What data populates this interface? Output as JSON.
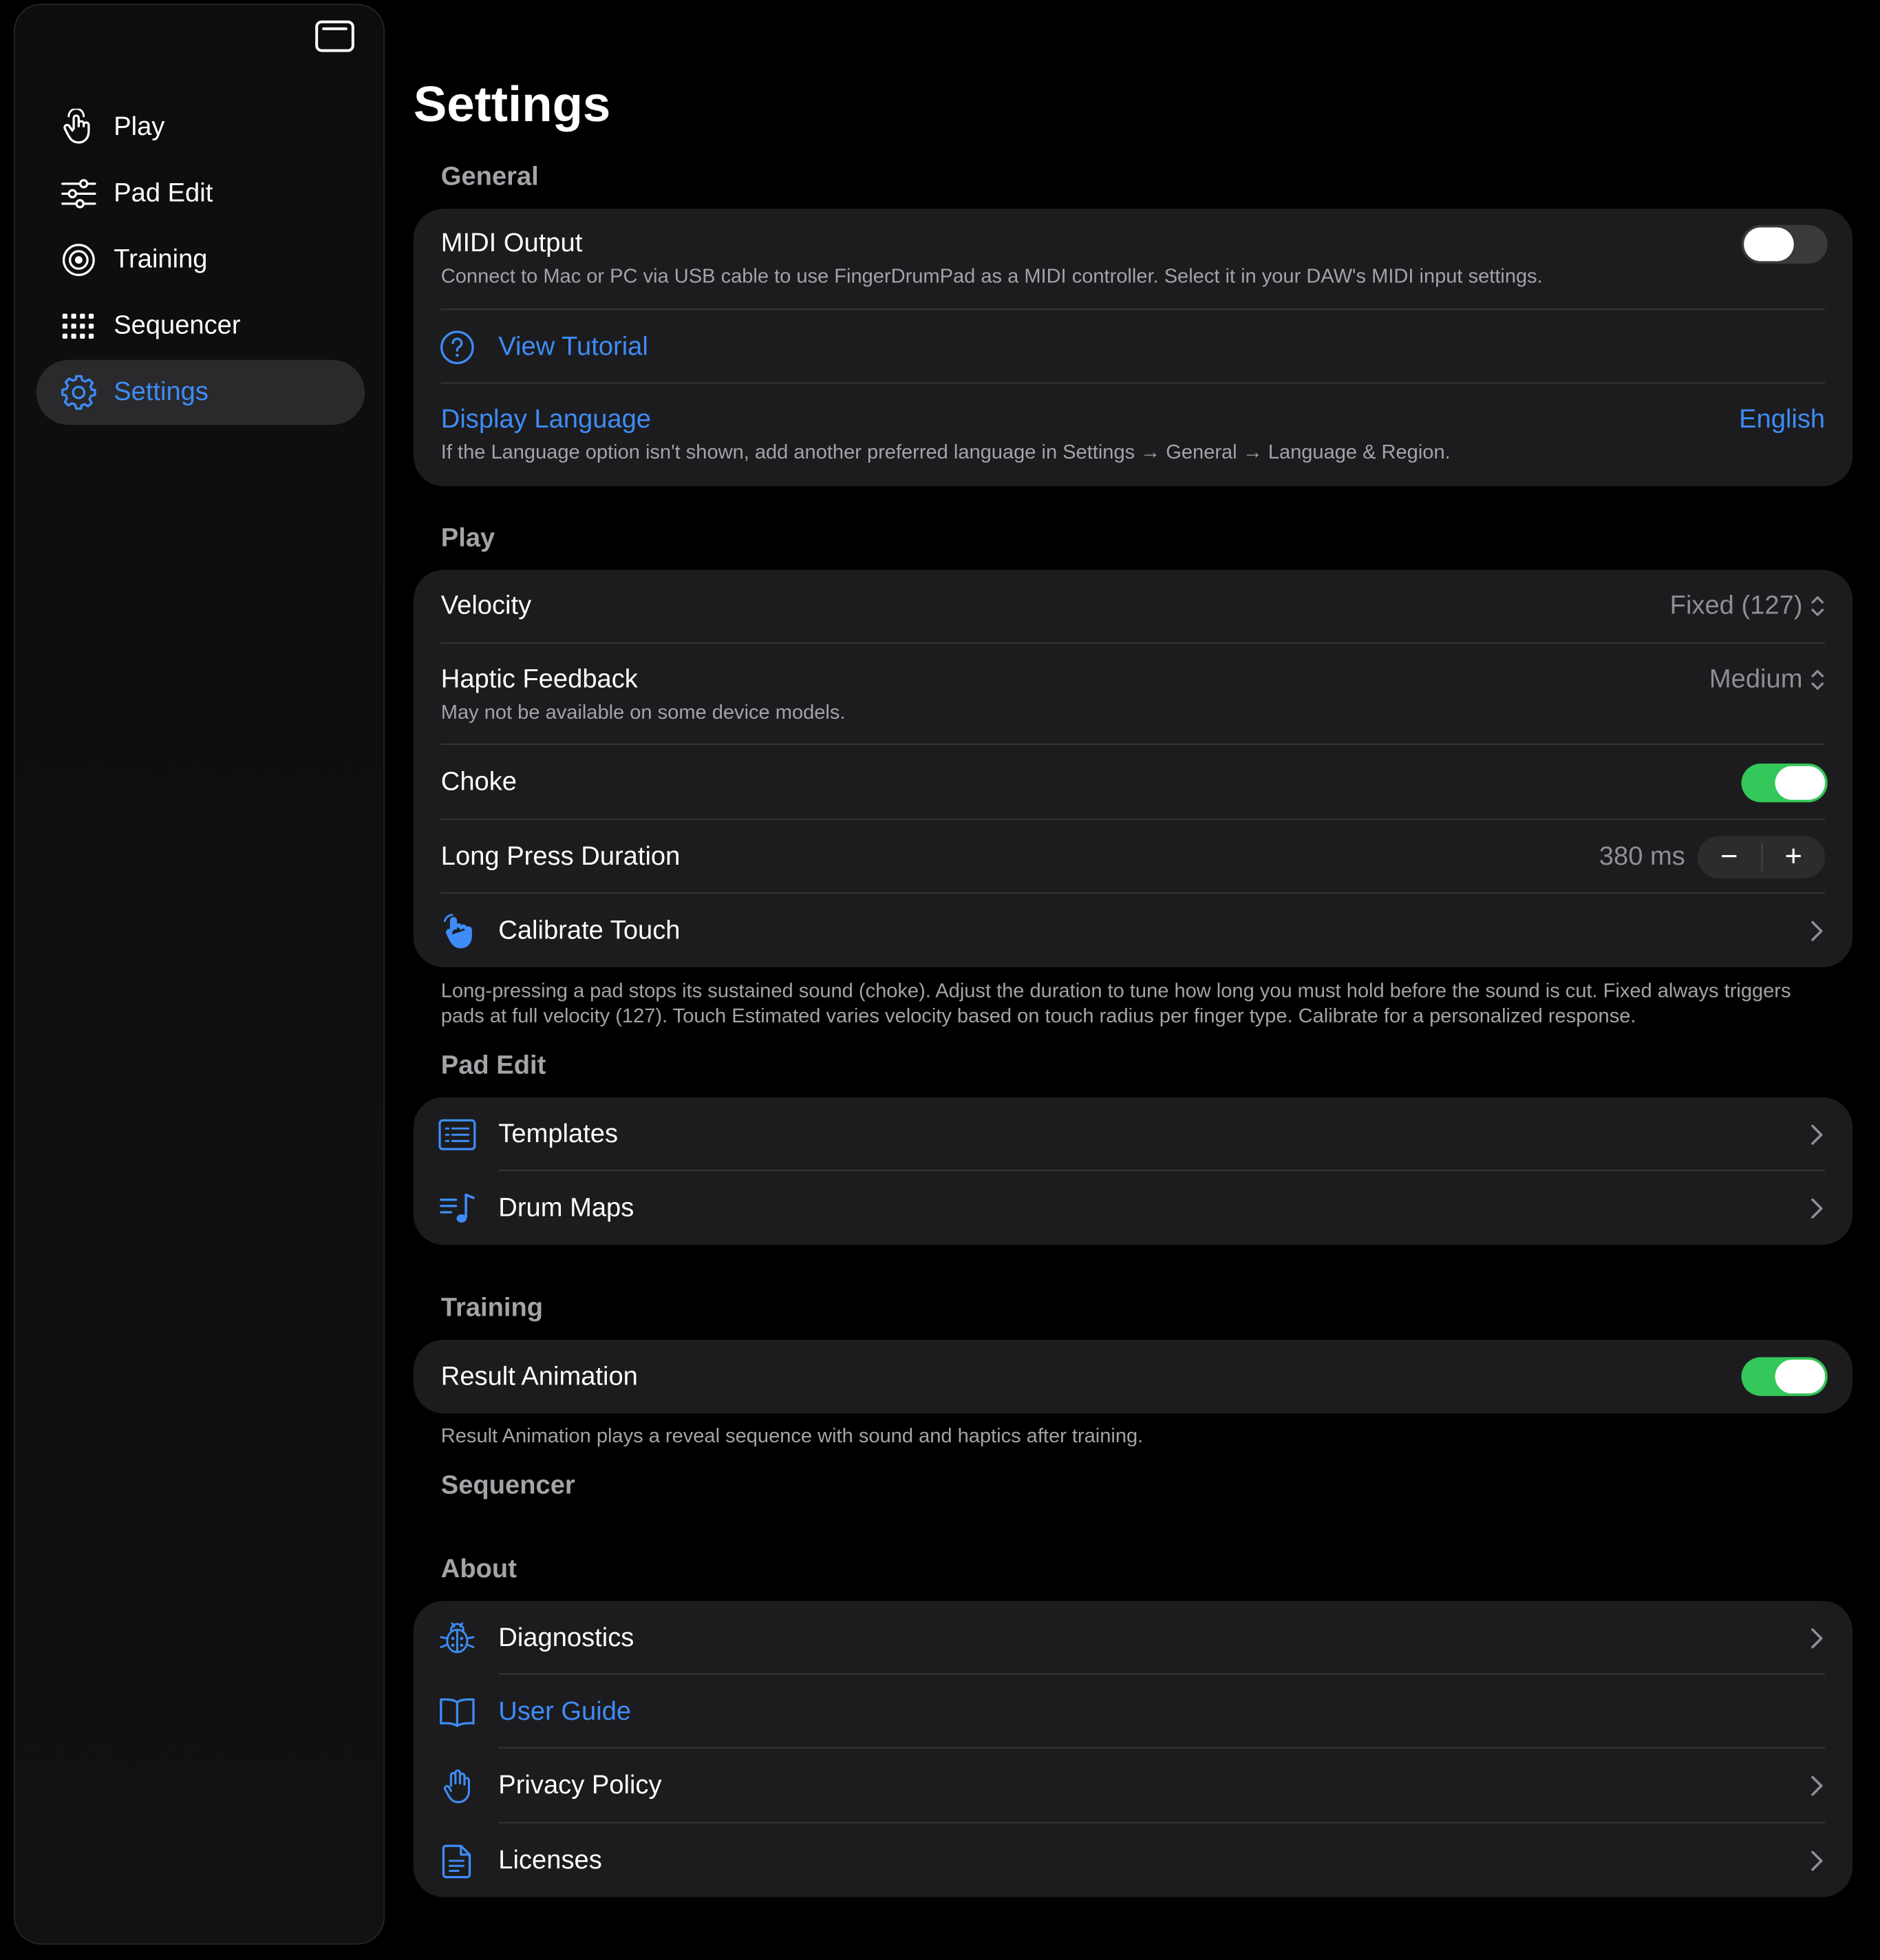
{
  "sidebar": {
    "items": [
      {
        "label": "Play",
        "icon": "hand-tap-icon",
        "active": false
      },
      {
        "label": "Pad Edit",
        "icon": "sliders-icon",
        "active": false
      },
      {
        "label": "Training",
        "icon": "target-icon",
        "active": false
      },
      {
        "label": "Sequencer",
        "icon": "grid-dots-icon",
        "active": false
      },
      {
        "label": "Settings",
        "icon": "gear-icon",
        "active": true
      }
    ]
  },
  "page": {
    "title": "Settings"
  },
  "general": {
    "header": "General",
    "midi_output": {
      "title": "MIDI Output",
      "subtitle": "Connect to Mac or PC via USB cable to use FingerDrumPad as a MIDI controller. Select it in your DAW's MIDI input settings.",
      "enabled": false
    },
    "view_tutorial": {
      "title": "View Tutorial"
    },
    "display_language": {
      "title": "Display Language",
      "value": "English",
      "subtitle": "If the Language option isn't shown, add another preferred language in Settings → General → Language & Region."
    }
  },
  "play": {
    "header": "Play",
    "velocity": {
      "title": "Velocity",
      "value": "Fixed (127)"
    },
    "haptic": {
      "title": "Haptic Feedback",
      "value": "Medium",
      "subtitle": "May not be available on some device models."
    },
    "choke": {
      "title": "Choke",
      "enabled": true
    },
    "long_press": {
      "title": "Long Press Duration",
      "value": "380 ms",
      "minus": "−",
      "plus": "+"
    },
    "calibrate": {
      "title": "Calibrate Touch"
    },
    "footnote": "Long-pressing a pad stops its sustained sound (choke). Adjust the duration to tune how long you must hold before the sound is cut. Fixed always triggers pads at full velocity (127). Touch Estimated varies velocity based on touch radius per finger type. Calibrate for a personalized response."
  },
  "pad_edit": {
    "header": "Pad Edit",
    "templates": {
      "title": "Templates"
    },
    "drum_maps": {
      "title": "Drum Maps"
    }
  },
  "training": {
    "header": "Training",
    "result_animation": {
      "title": "Result Animation",
      "enabled": true
    },
    "footnote": "Result Animation plays a reveal sequence with sound and haptics after training."
  },
  "sequencer": {
    "header": "Sequencer"
  },
  "about": {
    "header": "About",
    "diagnostics": {
      "title": "Diagnostics"
    },
    "user_guide": {
      "title": "User Guide"
    },
    "privacy": {
      "title": "Privacy Policy"
    },
    "licenses": {
      "title": "Licenses"
    }
  },
  "colors": {
    "accent": "#3e8cf7",
    "toggle_on": "#34c759",
    "group_bg": "#1c1c1e"
  }
}
